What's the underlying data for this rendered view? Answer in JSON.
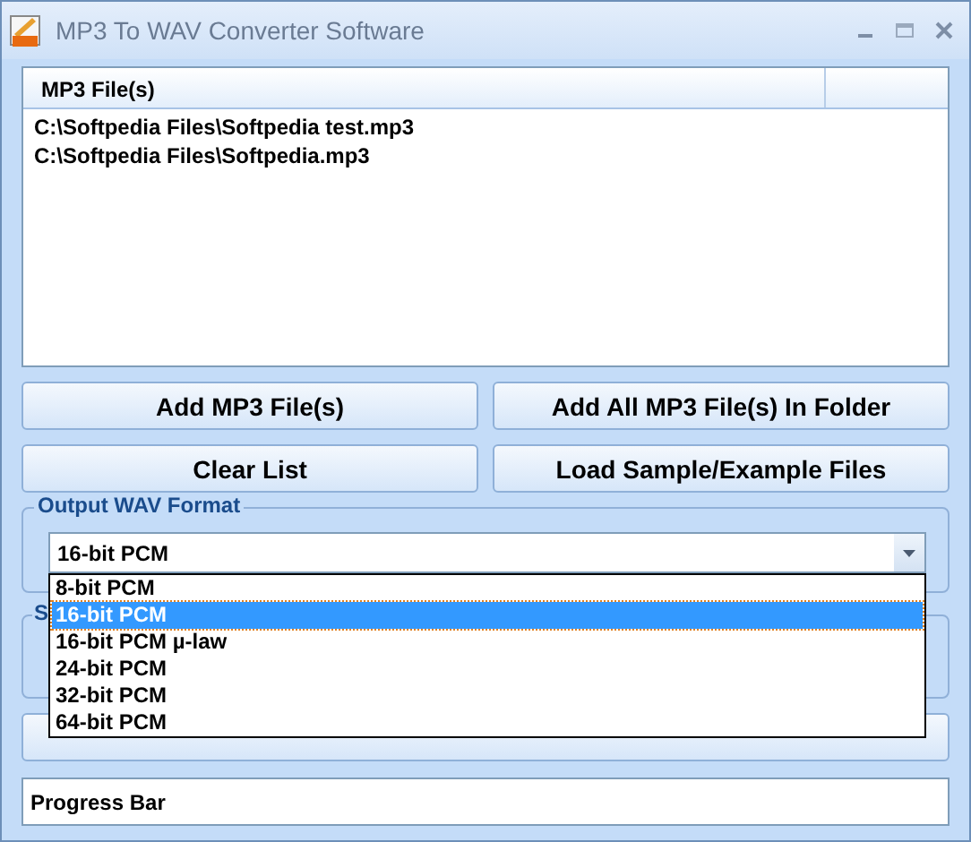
{
  "window": {
    "title": "MP3 To WAV Converter Software"
  },
  "file_list": {
    "columns": [
      "MP3 File(s)"
    ],
    "rows": [
      "C:\\Softpedia Files\\Softpedia test.mp3",
      "C:\\Softpedia Files\\Softpedia.mp3"
    ]
  },
  "buttons": [
    {
      "label": "Add MP3 File(s)"
    },
    {
      "label": "Add All MP3 File(s) In Folder"
    },
    {
      "label": "Clear List"
    },
    {
      "label": "Load Sample/Example Files"
    }
  ],
  "output_format": {
    "legend": "Output WAV Format",
    "value": "16-bit PCM",
    "expanded": true,
    "options": [
      {
        "label": "8-bit PCM",
        "selected": false
      },
      {
        "label": "16-bit PCM",
        "selected": true
      },
      {
        "label": "16-bit PCM µ-law",
        "selected": false
      },
      {
        "label": "24-bit PCM",
        "selected": false
      },
      {
        "label": "32-bit PCM",
        "selected": false
      },
      {
        "label": "64-bit PCM",
        "selected": false
      }
    ]
  },
  "second_group": {
    "legend": "S"
  },
  "progress_bar": {
    "label": "Progress Bar",
    "level": 0
  }
}
